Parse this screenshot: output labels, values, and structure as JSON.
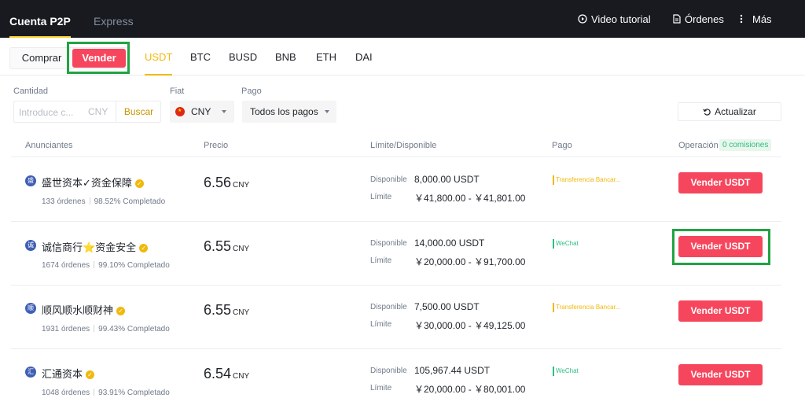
{
  "nav": {
    "tabs": [
      {
        "label": "Cuenta P2P"
      },
      {
        "label": "Express"
      }
    ],
    "links": [
      {
        "label": "Video tutorial"
      },
      {
        "label": "Órdenes"
      },
      {
        "label": "Más"
      }
    ]
  },
  "trade_type": {
    "buy_label": "Comprar",
    "sell_label": "Vender",
    "selected": "Vender"
  },
  "coins": [
    "USDT",
    "BTC",
    "BUSD",
    "BNB",
    "ETH",
    "DAI"
  ],
  "filters": {
    "amount_label": "Cantidad",
    "amount_placeholder": "Introduce c...",
    "amount_unit": "CNY",
    "search_label": "Buscar",
    "fiat_label": "Fiat",
    "fiat_value": "CNY",
    "payment_label": "Pago",
    "payment_value": "Todos los pagos",
    "refresh_label": "Actualizar"
  },
  "table": {
    "headers": [
      "Anunciantes",
      "Precio",
      "Límite/Disponible",
      "Pago",
      "Operación"
    ],
    "fee_badge": "0 comisiones",
    "rows": [
      {
        "avatar": "盛",
        "name": "盛世资本✓资金保障",
        "orders": "133 órdenes",
        "completion": "98.52% Completado",
        "price": "6.56",
        "currency": "CNY",
        "available_label": "Disponible",
        "available": "8,000.00 USDT",
        "limit_label": "Límite",
        "limit": "￥41,800.00 - ￥41,801.00",
        "payment": "Transferencia Bancar...",
        "button": "Vender USDT"
      },
      {
        "avatar": "诚",
        "name": "诚信商行⭐资金安全",
        "orders": "1674 órdenes",
        "completion": "99.10% Completado",
        "price": "6.55",
        "currency": "CNY",
        "available_label": "Disponible",
        "available": "14,000.00 USDT",
        "limit_label": "Límite",
        "limit": "￥20,000.00 - ￥91,700.00",
        "payment": "WeChat",
        "button": "Vender USDT"
      },
      {
        "avatar": "顺",
        "name": "顺风顺水顺财神",
        "orders": "1931 órdenes",
        "completion": "99.43% Completado",
        "price": "6.55",
        "currency": "CNY",
        "available_label": "Disponible",
        "available": "7,500.00 USDT",
        "limit_label": "Límite",
        "limit": "￥30,000.00 - ￥49,125.00",
        "payment": "Transferencia Bancar...",
        "button": "Vender USDT"
      },
      {
        "avatar": "汇",
        "name": "汇通资本",
        "orders": "1048 órdenes",
        "completion": "93.91% Completado",
        "price": "6.54",
        "currency": "CNY",
        "available_label": "Disponible",
        "available": "105,967.44 USDT",
        "limit_label": "Límite",
        "limit": "￥20,000.00 - ￥80,001.00",
        "payment": "WeChat",
        "button": "Vender USDT"
      }
    ]
  },
  "colors": {
    "sell": "#f6465d",
    "accent": "#f0b90b",
    "highlight": "#21a342",
    "bank": "#f0b90b",
    "wechat": "#2ebd85"
  }
}
